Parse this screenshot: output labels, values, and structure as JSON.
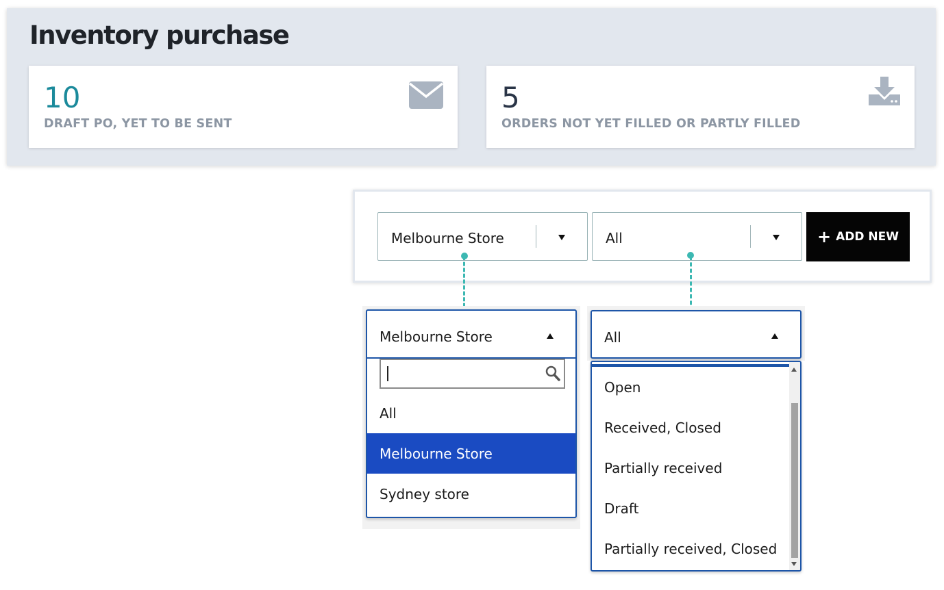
{
  "page": {
    "title": "Inventory purchase"
  },
  "stats": [
    {
      "value": "10",
      "label": "DRAFT PO, YET TO BE SENT",
      "icon": "envelope-icon",
      "value_color": "#1b8a9b"
    },
    {
      "value": "5",
      "label": "ORDERS NOT YET FILLED OR PARTLY FILLED",
      "icon": "download-icon",
      "value_color": "#2a3547"
    }
  ],
  "toolbar": {
    "store_select": {
      "value": "Melbourne Store"
    },
    "status_select": {
      "value": "All"
    },
    "add_button": {
      "label": "ADD NEW"
    }
  },
  "store_dropdown": {
    "selected": "Melbourne Store",
    "search_value": "",
    "options": [
      "All",
      "Melbourne Store",
      "Sydney store"
    ]
  },
  "status_dropdown": {
    "selected": "All",
    "options": [
      "Open",
      "Received, Closed",
      "Partially received",
      "Draft",
      "Partially received, Closed"
    ]
  },
  "colors": {
    "accent": "#3cb8b2",
    "selection": "#1a4bc2",
    "focus_border": "#1d55a8"
  }
}
